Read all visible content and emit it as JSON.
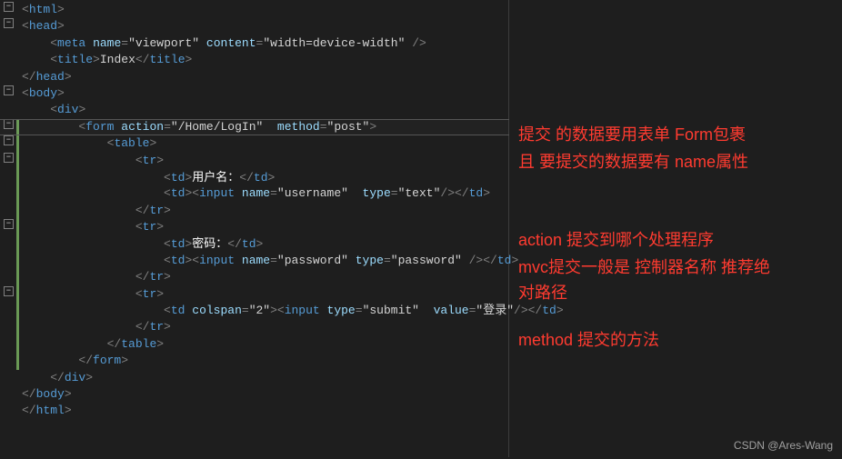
{
  "code": {
    "lines": [
      {
        "indent": 0,
        "html": "<span class='p'>&lt;</span><span class='tg'>html</span><span class='p'>&gt;</span>"
      },
      {
        "indent": 0,
        "html": "<span class='p'>&lt;</span><span class='tg'>head</span><span class='p'>&gt;</span>"
      },
      {
        "indent": 1,
        "html": "<span class='p'>&lt;</span><span class='tg'>meta</span> <span class='at'>name</span><span class='p'>=</span><span class='st'>\"viewport\"</span> <span class='at'>content</span><span class='p'>=</span><span class='st'>\"width=device-width\"</span> <span class='p'>/&gt;</span>"
      },
      {
        "indent": 1,
        "html": "<span class='p'>&lt;</span><span class='tg'>title</span><span class='p'>&gt;</span><span class='tx'>Index</span><span class='p'>&lt;/</span><span class='tg'>title</span><span class='p'>&gt;</span>"
      },
      {
        "indent": 0,
        "html": "<span class='p'>&lt;/</span><span class='tg'>head</span><span class='p'>&gt;</span>"
      },
      {
        "indent": 0,
        "html": "<span class='p'>&lt;</span><span class='tg'>body</span><span class='p'>&gt;</span>"
      },
      {
        "indent": 1,
        "html": "<span class='p'>&lt;</span><span class='tg'>div</span><span class='p'>&gt;</span>"
      },
      {
        "indent": 2,
        "html": "<span class='p'>&lt;</span><span class='tg'>form</span> <span class='at'>action</span><span class='p'>=</span><span class='st'>\"/Home/LogIn\"</span>  <span class='at'>method</span><span class='p'>=</span><span class='st'>\"post\"</span><span class='p'>&gt;</span>"
      },
      {
        "indent": 3,
        "html": "<span class='p'>&lt;</span><span class='tg'>table</span><span class='p'>&gt;</span>"
      },
      {
        "indent": 4,
        "html": "<span class='p'>&lt;</span><span class='tg'>tr</span><span class='p'>&gt;</span>"
      },
      {
        "indent": 5,
        "html": "<span class='p'>&lt;</span><span class='tg'>td</span><span class='p'>&gt;</span><span class='wh'>用户名：</span><span class='p'>&lt;/</span><span class='tg'>td</span><span class='p'>&gt;</span>"
      },
      {
        "indent": 5,
        "html": "<span class='p'>&lt;</span><span class='tg'>td</span><span class='p'>&gt;&lt;</span><span class='tg'>input</span> <span class='at'>name</span><span class='p'>=</span><span class='st'>\"username\"</span>  <span class='at'>type</span><span class='p'>=</span><span class='st'>\"text\"</span><span class='p'>/&gt;&lt;/</span><span class='tg'>td</span><span class='p'>&gt;</span>"
      },
      {
        "indent": 4,
        "html": "<span class='p'>&lt;/</span><span class='tg'>tr</span><span class='p'>&gt;</span>"
      },
      {
        "indent": 4,
        "html": "<span class='p'>&lt;</span><span class='tg'>tr</span><span class='p'>&gt;</span>"
      },
      {
        "indent": 5,
        "html": "<span class='p'>&lt;</span><span class='tg'>td</span><span class='p'>&gt;</span><span class='wh'>密码：</span><span class='p'>&lt;/</span><span class='tg'>td</span><span class='p'>&gt;</span>"
      },
      {
        "indent": 5,
        "html": "<span class='p'>&lt;</span><span class='tg'>td</span><span class='p'>&gt;&lt;</span><span class='tg'>input</span> <span class='at'>name</span><span class='p'>=</span><span class='st'>\"password\"</span> <span class='at'>type</span><span class='p'>=</span><span class='st'>\"password\"</span> <span class='p'>/&gt;&lt;/</span><span class='tg'>td</span><span class='p'>&gt;</span>"
      },
      {
        "indent": 4,
        "html": "<span class='p'>&lt;/</span><span class='tg'>tr</span><span class='p'>&gt;</span>"
      },
      {
        "indent": 4,
        "html": "<span class='p'>&lt;</span><span class='tg'>tr</span><span class='p'>&gt;</span>"
      },
      {
        "indent": 5,
        "html": "<span class='p'>&lt;</span><span class='tg'>td</span> <span class='at'>colspan</span><span class='p'>=</span><span class='st'>\"2\"</span><span class='p'>&gt;&lt;</span><span class='tg'>input</span> <span class='at'>type</span><span class='p'>=</span><span class='st'>\"submit\"</span>  <span class='at'>value</span><span class='p'>=</span><span class='st'>\"登录\"</span><span class='p'>/&gt;&lt;/</span><span class='tg'>td</span><span class='p'>&gt;</span>"
      },
      {
        "indent": 4,
        "html": "<span class='p'>&lt;/</span><span class='tg'>tr</span><span class='p'>&gt;</span>"
      },
      {
        "indent": 3,
        "html": "<span class='p'>&lt;/</span><span class='tg'>table</span><span class='p'>&gt;</span>"
      },
      {
        "indent": 2,
        "html": "<span class='p'>&lt;/</span><span class='tg'>form</span><span class='p'>&gt;</span>"
      },
      {
        "indent": 1,
        "html": "<span class='p'>&lt;/</span><span class='tg'>div</span><span class='p'>&gt;</span>"
      },
      {
        "indent": 0,
        "html": "<span class='p'>&lt;/</span><span class='tg'>body</span><span class='p'>&gt;</span>"
      },
      {
        "indent": 0,
        "html": "<span class='p'>&lt;/</span><span class='tg'>html</span><span class='p'>&gt;</span>"
      }
    ],
    "folds": [
      "-",
      "-",
      "",
      "",
      "",
      "-",
      "",
      "-",
      "-",
      "-",
      "",
      "",
      "",
      "-",
      "",
      "",
      "",
      "-",
      "",
      "",
      "",
      "",
      "",
      "",
      ""
    ],
    "highlight_index": 7,
    "change_bar": {
      "start_index": 7,
      "end_index": 21
    }
  },
  "annotations": {
    "a1": "提交 的数据要用表单  Form包裹",
    "a2": "且 要提交的数据要有  name属性",
    "a3": "action  提交到哪个处理程序",
    "a4": "mvc提交一般是 控制器名称  推荐绝",
    "a5": "对路径",
    "a6": "method  提交的方法"
  },
  "watermark": "CSDN @Ares-Wang"
}
